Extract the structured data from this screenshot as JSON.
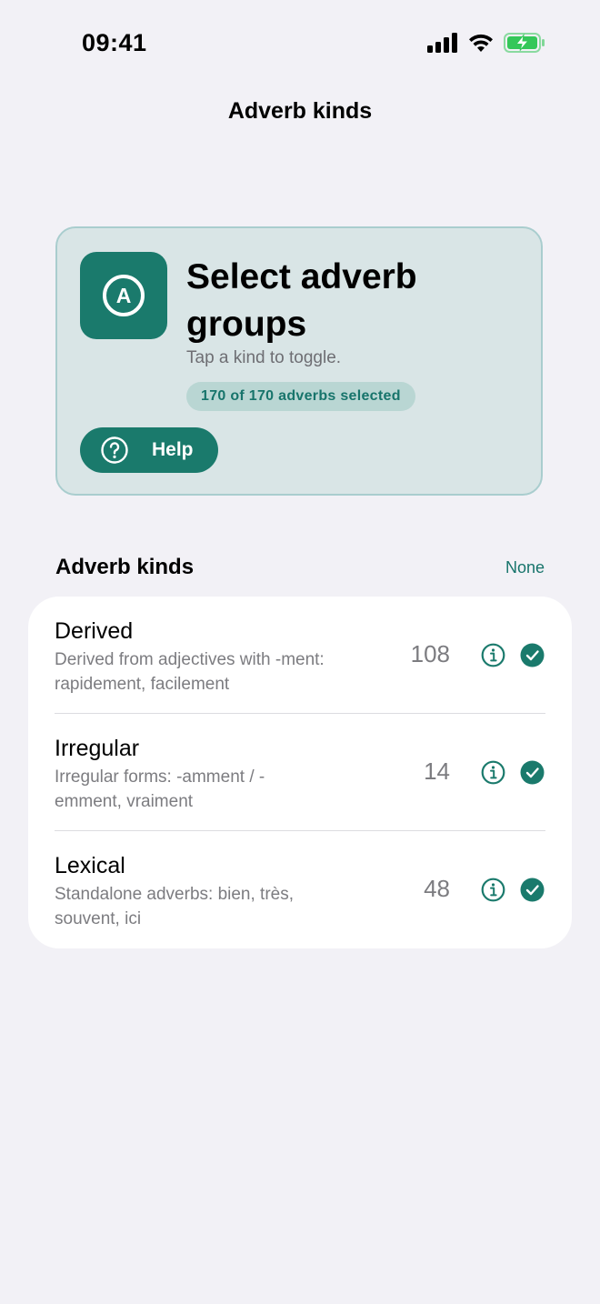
{
  "status_bar": {
    "time": "09:41",
    "icons": [
      "cellular-signal-icon",
      "wifi-icon",
      "battery-charging-icon"
    ]
  },
  "nav": {
    "title": "Adverb kinds"
  },
  "hero": {
    "icon_letter": "A",
    "title": "Select adverb groups",
    "subtitle": "Tap a kind to toggle.",
    "badge": "170 of 170 adverbs selected",
    "help_label": "Help"
  },
  "section": {
    "title": "Adverb kinds",
    "action": "None"
  },
  "kinds": [
    {
      "name": "Derived",
      "description": "Derived from adjectives with -ment: rapidement, facilement",
      "count": "108",
      "selected": true
    },
    {
      "name": "Irregular",
      "description": "Irregular forms: -amment / -emment, vraiment",
      "count": "14",
      "selected": true
    },
    {
      "name": "Lexical",
      "description": "Standalone adverbs: bien, très, souvent, ici",
      "count": "48",
      "selected": true
    }
  ],
  "colors": {
    "accent": "#1a7a6c",
    "accent_text": "#17746b",
    "background": "#f2f1f6",
    "hero_bg": "#d9e5e6",
    "battery_green": "#34c759"
  }
}
